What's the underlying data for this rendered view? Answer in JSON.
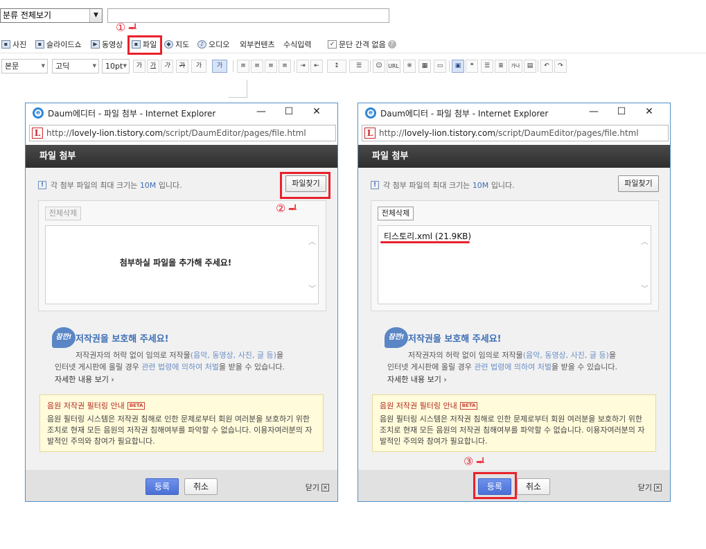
{
  "editor": {
    "category_select": "분류 전체보기",
    "insert_bar": {
      "photo": "사진",
      "slideshow": "슬라이드쇼",
      "video": "동영상",
      "file": "파일",
      "map": "지도",
      "audio": "오디오",
      "external": "외부컨텐츠",
      "formula": "수식입력",
      "no_paragraph_spacing": "문단 간격 없음",
      "help": "?"
    },
    "format_bar": {
      "paragraph_style": "본문",
      "font": "고딕",
      "font_size": "10pt",
      "bold": "가",
      "underline": "가",
      "italic": "가",
      "strike": "가",
      "font_color": "가",
      "bg_color": "가",
      "link": "URL",
      "special_char": "※",
      "quote": "❝",
      "more": "가나"
    }
  },
  "annotations": {
    "step1": "①",
    "step2": "②",
    "step3": "③",
    "cursor": "ᆗ"
  },
  "popup": {
    "title": "Daum에디터 - 파일 첨부 - Internet Explorer",
    "controls": {
      "minimize": "—",
      "maximize": "☐",
      "close": "✕"
    },
    "url_prefix": "http://",
    "url_host": "lovely-lion.tistory.com",
    "url_path": "/script/DaumEditor/pages/file.html",
    "header": "파일 첨부",
    "notice_prefix": "각 첨부 파일의 최대 크기는",
    "notice_limit": "10M",
    "notice_suffix": "입니다.",
    "find_button": "파일찾기",
    "delete_all_button": "전체삭제",
    "empty_message": "첨부하실 파일을 추가해 주세요!",
    "attached_file": "티스토리.xml (21.9KB)",
    "copyright": {
      "badge": "잠깐!",
      "title": "저작권을 보호해 주세요!",
      "line1_prefix": "저작권자의 허락 없이 임의로 저작물",
      "line1_hl": "(음악, 동영상, 사진, 글 등)",
      "line1_suffix": "을",
      "line2_prefix": "인터넷 게시판에 올릴 경우",
      "line2_hl": "관련 법령에 의하여 처벌",
      "line2_suffix": "을 받을 수 있습니다.",
      "more": "자세한 내용 보기 ›"
    },
    "filter": {
      "title": "음원 저작권 필터링 안내",
      "beta": "BETA",
      "text": "음원 필터링 시스템은 저작권 침해로 인한 문제로부터 회원 여러분을 보호하기 위한 조치로 현재 모든 음원의 저작권 침해여부를 파악할 수 없습니다. 이용자여러분의 자발적인 주의와 참여가 필요합니다."
    },
    "register_button": "등록",
    "cancel_button": "취소",
    "close_link": "닫기",
    "close_x": "✕"
  }
}
